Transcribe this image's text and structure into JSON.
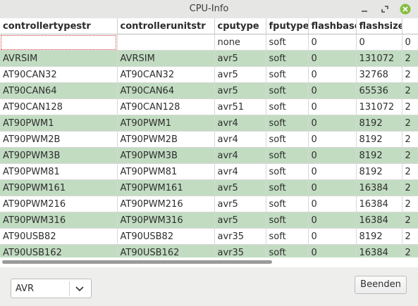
{
  "window": {
    "title": "CPU-Info"
  },
  "table": {
    "columns": [
      "controllertypestr",
      "controllerunitstr",
      "cputype",
      "fputype",
      "flashbase",
      "flashsize",
      ""
    ],
    "rows": [
      [
        "",
        "",
        "none",
        "soft",
        "0",
        "0",
        "0"
      ],
      [
        "AVRSIM",
        "AVRSIM",
        "avr5",
        "soft",
        "0",
        "131072",
        "2"
      ],
      [
        "AT90CAN32",
        "AT90CAN32",
        "avr5",
        "soft",
        "0",
        "32768",
        "2"
      ],
      [
        "AT90CAN64",
        "AT90CAN64",
        "avr5",
        "soft",
        "0",
        "65536",
        "2"
      ],
      [
        "AT90CAN128",
        "AT90CAN128",
        "avr51",
        "soft",
        "0",
        "131072",
        "2"
      ],
      [
        "AT90PWM1",
        "AT90PWM1",
        "avr4",
        "soft",
        "0",
        "8192",
        "2"
      ],
      [
        "AT90PWM2B",
        "AT90PWM2B",
        "avr4",
        "soft",
        "0",
        "8192",
        "2"
      ],
      [
        "AT90PWM3B",
        "AT90PWM3B",
        "avr4",
        "soft",
        "0",
        "8192",
        "2"
      ],
      [
        "AT90PWM81",
        "AT90PWM81",
        "avr4",
        "soft",
        "0",
        "8192",
        "2"
      ],
      [
        "AT90PWM161",
        "AT90PWM161",
        "avr5",
        "soft",
        "0",
        "16384",
        "2"
      ],
      [
        "AT90PWM216",
        "AT90PWM216",
        "avr5",
        "soft",
        "0",
        "16384",
        "2"
      ],
      [
        "AT90PWM316",
        "AT90PWM316",
        "avr5",
        "soft",
        "0",
        "16384",
        "2"
      ],
      [
        "AT90USB82",
        "AT90USB82",
        "avr35",
        "soft",
        "0",
        "8192",
        "2"
      ],
      [
        "AT90USB162",
        "AT90USB162",
        "avr35",
        "soft",
        "0",
        "16384",
        "2"
      ]
    ]
  },
  "footer": {
    "architecture_select": "AVR",
    "close_button": "Beenden"
  },
  "colors": {
    "row_highlight": "#c2dcc2",
    "close_icon": "#86be43"
  }
}
